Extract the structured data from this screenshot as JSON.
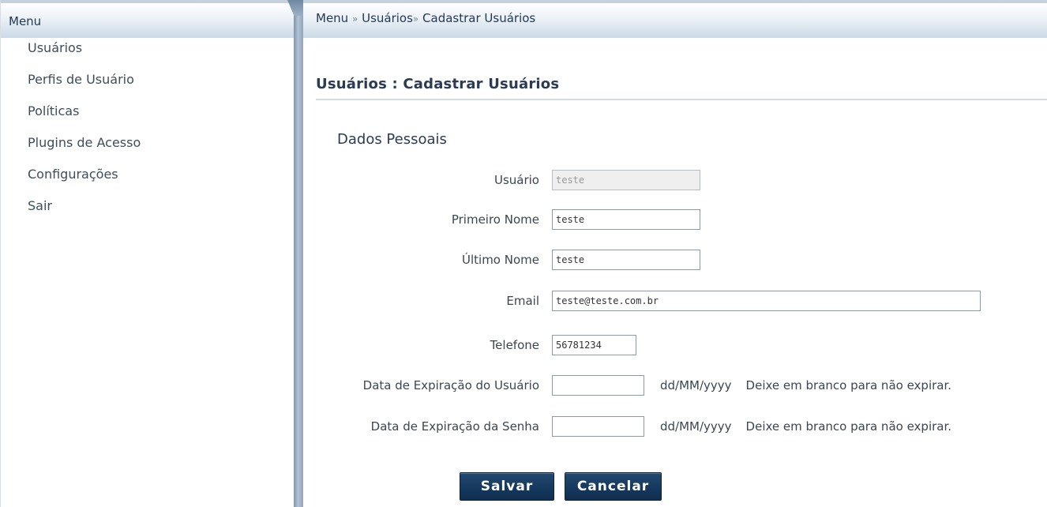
{
  "sidebar": {
    "title": "Menu",
    "items": [
      {
        "label": "Usuários"
      },
      {
        "label": "Perfis de Usuário"
      },
      {
        "label": "Políticas"
      },
      {
        "label": "Plugins de Acesso"
      },
      {
        "label": "Configurações"
      },
      {
        "label": "Sair"
      }
    ]
  },
  "breadcrumb": {
    "items": [
      "Menu",
      "Usuários",
      "Cadastrar Usuários"
    ],
    "separator_1": "»",
    "separator_2": "»"
  },
  "page": {
    "title": "Usuários : Cadastrar Usuários",
    "section": "Dados Pessoais"
  },
  "form": {
    "usuario": {
      "label": "Usuário",
      "value": "teste"
    },
    "primeiro_nome": {
      "label": "Primeiro Nome",
      "value": "teste"
    },
    "ultimo_nome": {
      "label": "Último Nome",
      "value": "teste"
    },
    "email": {
      "label": "Email",
      "value": "teste@teste.com.br"
    },
    "telefone": {
      "label": "Telefone",
      "value": "56781234"
    },
    "expiracao_usuario": {
      "label": "Data de Expiração do Usuário",
      "value": "",
      "format": "dd/MM/yyyy",
      "hint": "Deixe em branco para não expirar."
    },
    "expiracao_senha": {
      "label": "Data de Expiração da Senha",
      "value": "",
      "format": "dd/MM/yyyy",
      "hint": "Deixe em branco para não expirar."
    }
  },
  "buttons": {
    "save": "Salvar",
    "cancel": "Cancelar"
  }
}
